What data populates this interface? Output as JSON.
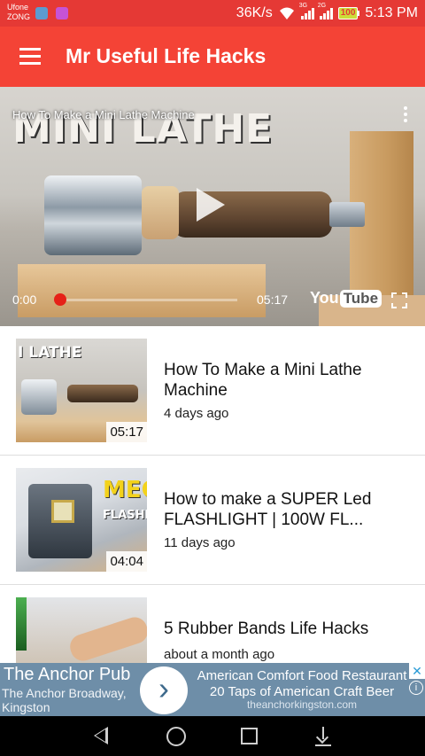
{
  "status_bar": {
    "carrier1": "Ufone",
    "carrier2": "ZONG",
    "speed": "36K/s",
    "net1": "3G",
    "net2": "2G",
    "battery": "100",
    "time": "5:13 PM"
  },
  "app_bar": {
    "title": "Mr Useful Life Hacks"
  },
  "player": {
    "title": "How To Make a Mini Lathe Machine",
    "thumb_text": "MINI LATHE",
    "current_time": "0:00",
    "duration": "05:17",
    "progress": 0,
    "logo_you": "You",
    "logo_tube": "Tube"
  },
  "videos": [
    {
      "title": "How To Make a Mini Lathe Machine",
      "meta": "4 days ago",
      "duration": "05:17",
      "thumb_text": "I LATHE"
    },
    {
      "title": "How to make a SUPER Led FLASHLIGHT | 100W FL...",
      "meta": "11 days ago",
      "duration": "04:04",
      "thumb_text": "MEG",
      "thumb_text2": "FLASHLI"
    },
    {
      "title": "5 Rubber Bands Life Hacks",
      "meta": "about a month ago"
    }
  ],
  "ad": {
    "name": "The Anchor Pub",
    "address": "The Anchor Broadway, Kingston",
    "headline": "American Comfort Food Restaurant 20 Taps of American Craft Beer",
    "url": "theanchorkingston.com",
    "arrow": "›",
    "close": "✕",
    "info": "i"
  },
  "colors": {
    "status_bar": "#e53935",
    "app_bar": "#f44336",
    "progress_knob": "#e62117",
    "ad_background": "#6e8ea8"
  }
}
